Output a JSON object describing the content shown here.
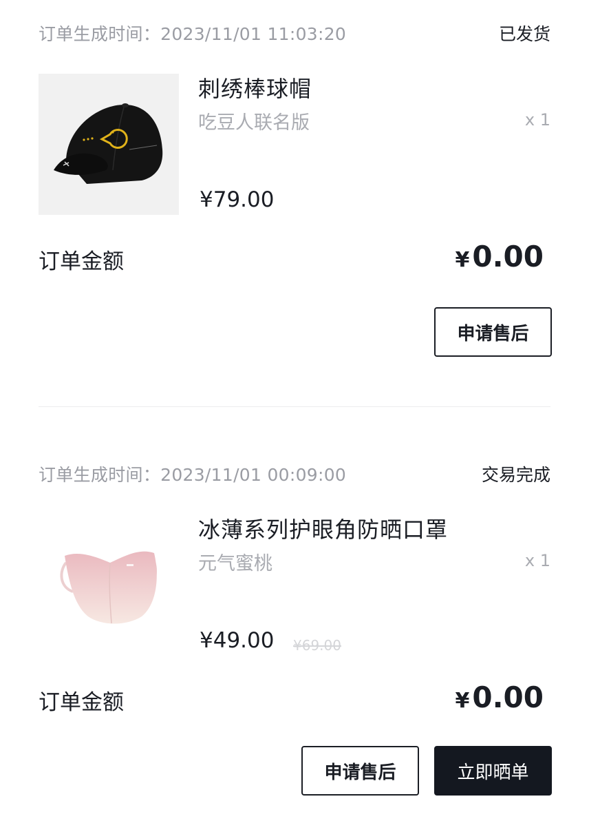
{
  "orders": [
    {
      "created_label": "订单生成时间：",
      "created_time": "2023/11/01 11:03:20",
      "status": "已发货",
      "product": {
        "image_icon": "baseball-cap-image",
        "title": "刺绣棒球帽",
        "variant": "吃豆人联名版",
        "qty": "x 1",
        "price": "¥79.00"
      },
      "total_label": "订单金额",
      "total_currency": "¥",
      "total_amount": "0.00",
      "buttons": {
        "after_sale": "申请售后"
      }
    },
    {
      "created_label": "订单生成时间：",
      "created_time": "2023/11/01 00:09:00",
      "status": "交易完成",
      "product": {
        "image_icon": "face-mask-image",
        "title": "冰薄系列护眼角防晒口罩",
        "variant": "元气蜜桃",
        "qty": "x 1",
        "price": "¥49.00",
        "original_price": "¥69.00"
      },
      "total_label": "订单金额",
      "total_currency": "¥",
      "total_amount": "0.00",
      "buttons": {
        "after_sale": "申请售后",
        "share_review": "立即晒单"
      }
    }
  ],
  "colors": {
    "text_primary": "#1a1d24",
    "text_secondary": "#9a9ca3",
    "solid_button": "#141820"
  }
}
